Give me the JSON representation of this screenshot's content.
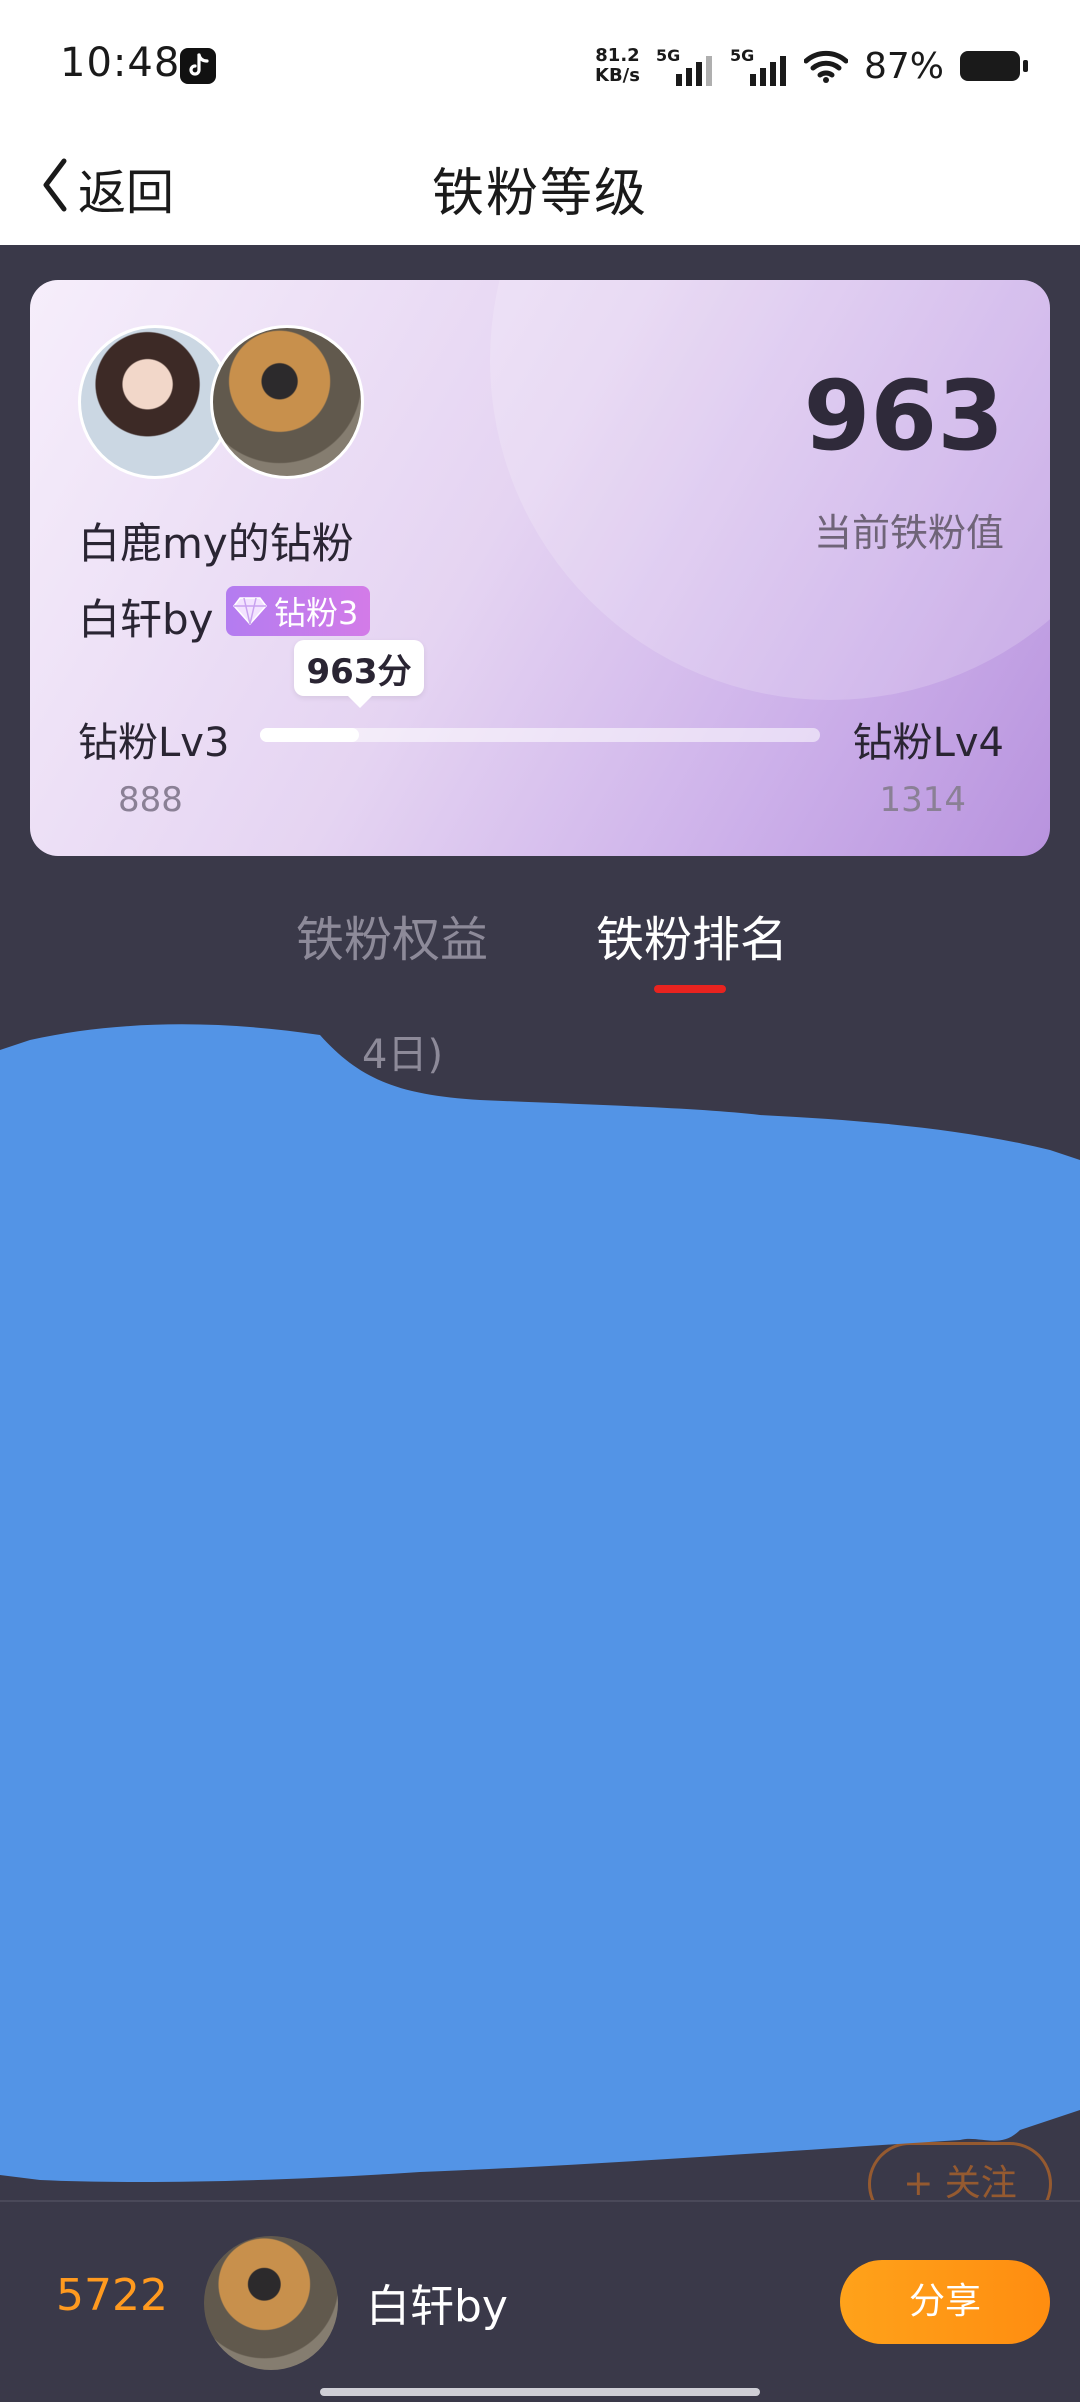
{
  "status": {
    "time": "10:48",
    "net_speed": [
      "81.2",
      "KB/s"
    ],
    "signal_label": "5G",
    "battery": "87%"
  },
  "nav": {
    "back_label": "返回",
    "title": "铁粉等级"
  },
  "card": {
    "fan_name": "白鹿my的钻粉",
    "value": "963",
    "value_label": "当前铁粉值",
    "user_name": "白轩by",
    "level_badge": "钻粉3",
    "score_bubble": "963分",
    "level_current": "钻粉Lv3",
    "level_next": "钻粉Lv4",
    "min_value": "888",
    "max_value": "1314",
    "progress": 0.177
  },
  "tabs": [
    {
      "label": "铁粉权益",
      "active": false
    },
    {
      "label": "铁粉排名",
      "active": true
    }
  ],
  "list_header_partial": "4日)",
  "partial_follow_label": "+ 关注",
  "footer": {
    "rank": "5722",
    "name": "白轩by",
    "share_label": "分享"
  },
  "colors": {
    "background": "#3a3949",
    "accent_orange": "#ff9a1f",
    "tab_underline": "#e8231f",
    "redaction_blue": "#5394e6"
  }
}
